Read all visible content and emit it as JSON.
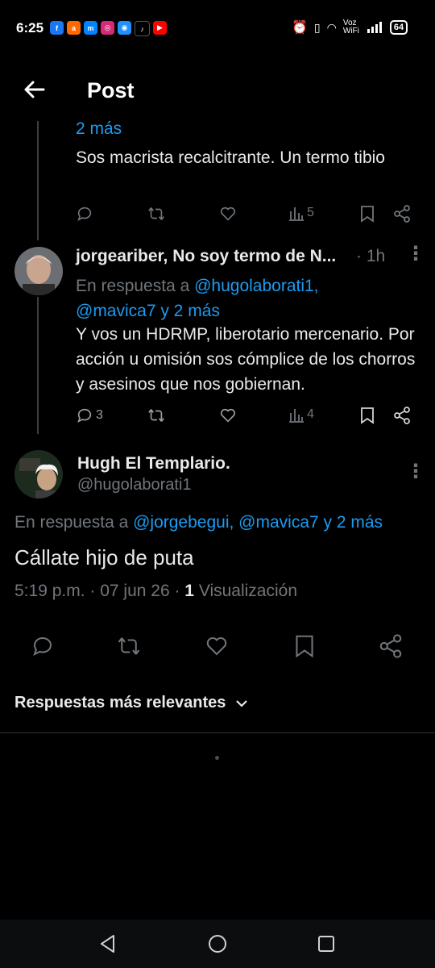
{
  "status_bar": {
    "time": "6:25",
    "voz": "Voz",
    "wifi": "WiFi",
    "battery": "64"
  },
  "header": {
    "title": "Post"
  },
  "reply1": {
    "more": "2 más",
    "text": "Sos macrista recalcitrante. Un termo tibio",
    "views": "5"
  },
  "reply2": {
    "author": "jorgeariber, No soy termo de N...",
    "time": "· 1h",
    "in_reply_prefix": "En respuesta a ",
    "mention1": "@hugolaborati1,",
    "mention2": "@mavica7 y 2 más",
    "text": "Y vos un HDRMP, liberotario mercenario. Por acción u omisión sos cómplice de los chorros y asesinos que nos gobiernan.",
    "replies": "3",
    "views": "4"
  },
  "main_post": {
    "author": "Hugh El Templario.",
    "handle": "@hugolaborati1",
    "in_reply_prefix": "En respuesta a ",
    "mentions": "@jorgebegui, @mavica7 y 2 más",
    "text": "Cállate hijo de puta",
    "timestamp": "5:19 p.m. · 07 jun 26 ·",
    "views_count": "1",
    "views_label": "Visualización"
  },
  "sort": {
    "label": "Respuestas más relevantes"
  },
  "colors": {
    "accent": "#1d9bf0",
    "bg": "#000000",
    "muted": "#71767b"
  }
}
